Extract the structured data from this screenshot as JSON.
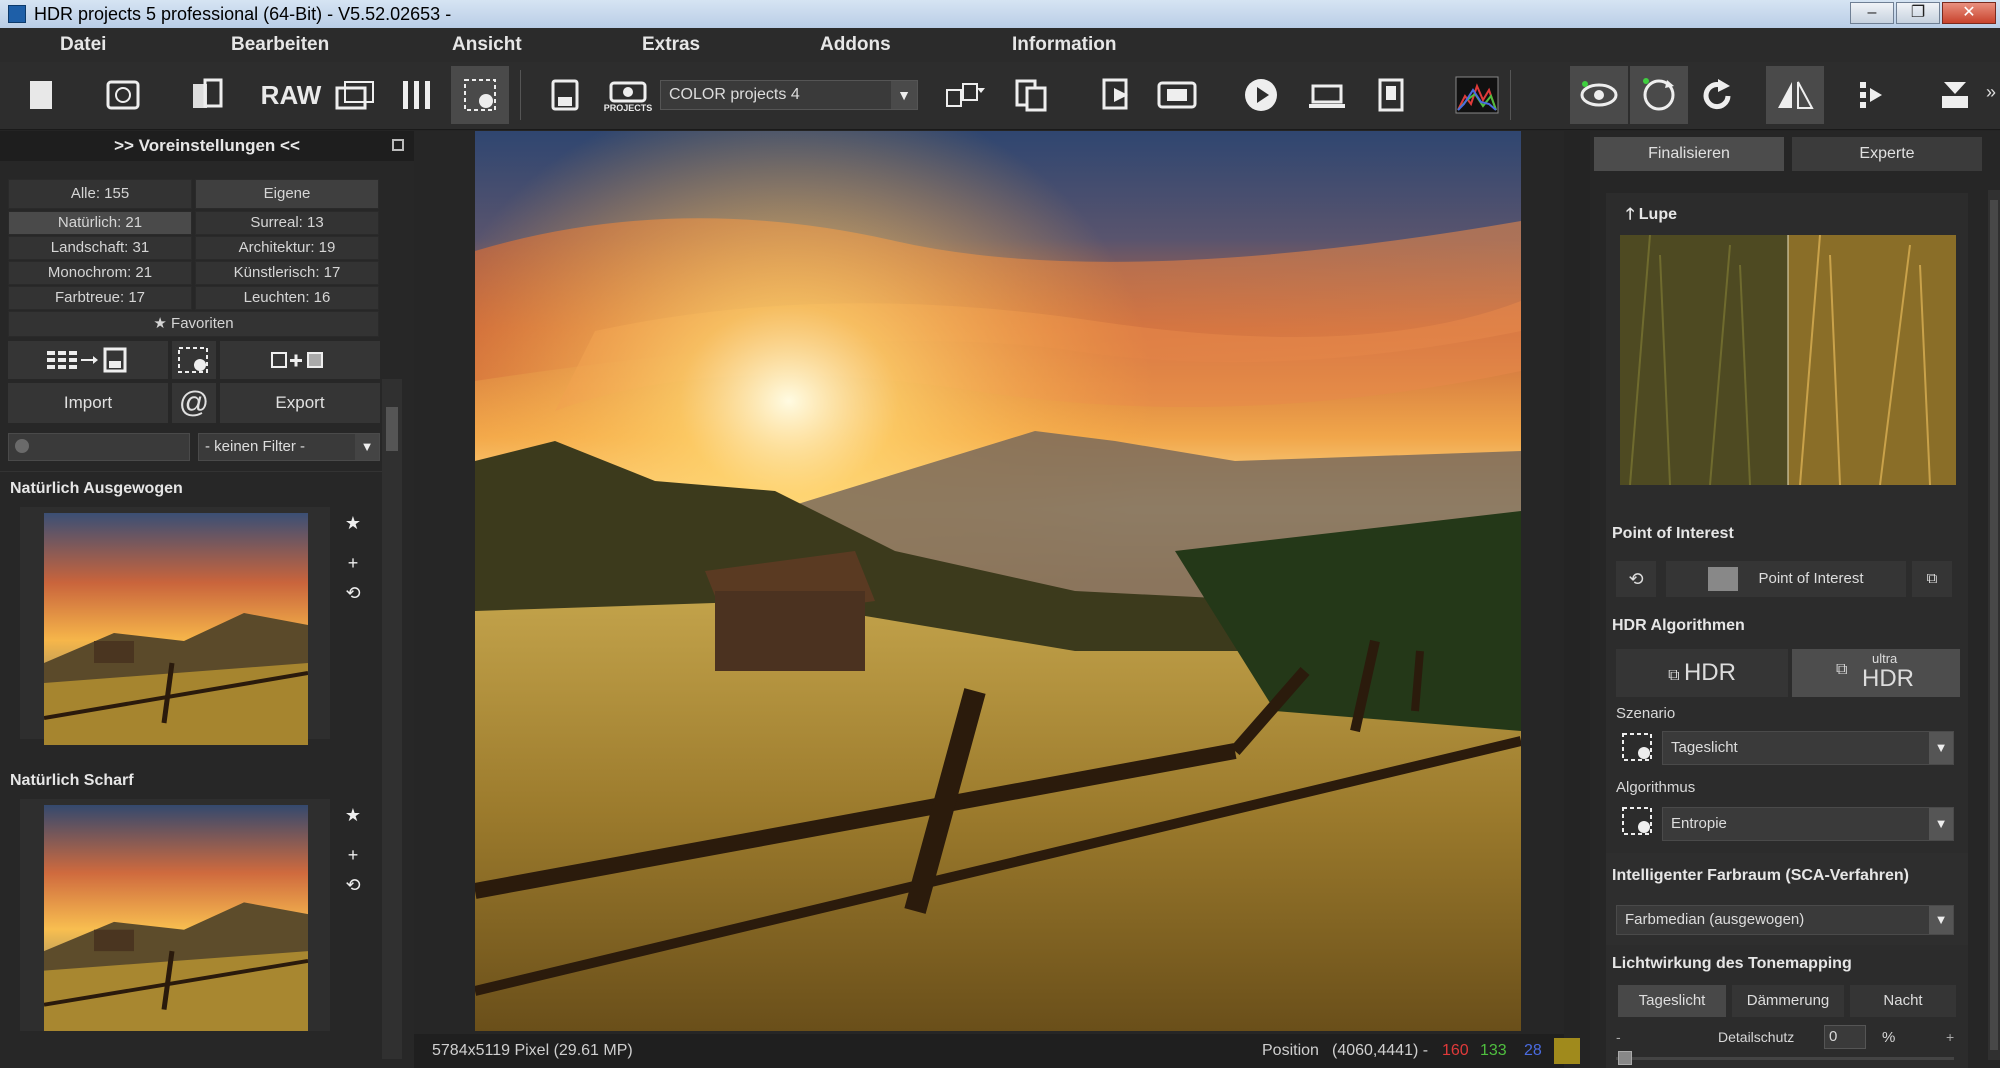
{
  "window": {
    "title": "HDR projects 5 professional (64-Bit) - V5.52.02653 -",
    "minimize": "–",
    "maximize": "❐",
    "close": "✕"
  },
  "menu": [
    "Datei",
    "Bearbeiten",
    "Ansicht",
    "Extras",
    "Addons",
    "Information"
  ],
  "toolbar": {
    "raw_label": "RAW",
    "projects_label": "PROJECTS",
    "preset_combo": "COLOR projects 4",
    "dropdown_arrow": "▼"
  },
  "presets": {
    "header": ">> Voreinstellungen <<",
    "categories": [
      {
        "label": "Alle: 155"
      },
      {
        "label": "Eigene"
      },
      {
        "label": "Natürlich: 21"
      },
      {
        "label": "Surreal: 13"
      },
      {
        "label": "Landschaft: 31"
      },
      {
        "label": "Architektur: 19"
      },
      {
        "label": "Monochrom: 21"
      },
      {
        "label": "Künstlerisch: 17"
      },
      {
        "label": "Farbtreue: 17"
      },
      {
        "label": "Leuchten: 16"
      }
    ],
    "favorites": "Favoriten",
    "import": "Import",
    "export": "Export",
    "at_symbol": "@",
    "filter": "- keinen Filter -",
    "items": [
      {
        "title": "Natürlich Ausgewogen"
      },
      {
        "title": "Natürlich Scharf"
      }
    ]
  },
  "status": {
    "dimensions": "5784x5119 Pixel (29.61 MP)",
    "position_label": "Position",
    "position": "(4060,4441) -",
    "r": "160",
    "g": "133",
    "b": "28",
    "colors": {
      "r": "#e03a3a",
      "g": "#4fbf3f",
      "b": "#4a6be0",
      "swatch": "#a08a1c"
    }
  },
  "right": {
    "tabs": [
      "Finalisieren",
      "Experte"
    ],
    "lupe": "Lupe",
    "poi_header": "Point of Interest",
    "poi_button": "Point of Interest",
    "hdr_header": "HDR Algorithmen",
    "hdr_button": "HDR",
    "ultra_small": "ultra",
    "ultra_big": "HDR",
    "szenario_label": "Szenario",
    "szenario_value": "Tageslicht",
    "algorithmus_label": "Algorithmus",
    "algorithmus_value": "Entropie",
    "sca_header": "Intelligenter Farbraum (SCA-Verfahren)",
    "sca_value": "Farbmedian (ausgewogen)",
    "light_header": "Lichtwirkung des Tonemapping",
    "light_tabs": [
      "Tageslicht",
      "Dämmerung",
      "Nacht"
    ],
    "detail_label": "Detailschutz",
    "detail_value": "0",
    "detail_unit": "%",
    "minus": "-",
    "plus": "+"
  }
}
